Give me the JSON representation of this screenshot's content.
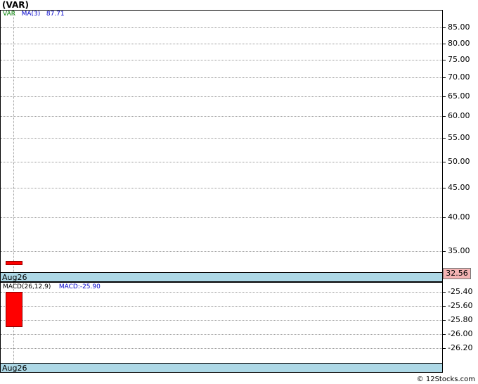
{
  "title": "(VAR)",
  "price_panel": {
    "legend_symbol": "VAR",
    "legend_ma": "MA(3)",
    "legend_ma_value": "87.71",
    "ticks": [
      "85.00",
      "80.00",
      "75.00",
      "70.00",
      "65.00",
      "60.00",
      "55.00",
      "50.00",
      "45.00",
      "40.00",
      "35.00"
    ],
    "last_price": "32.56",
    "date_label": "Aug26"
  },
  "macd_panel": {
    "legend_name": "MACD(26,12,9)",
    "legend_value": "MACD:-25.90",
    "ticks": [
      "-25.40",
      "-25.60",
      "-25.80",
      "-26.00",
      "-26.20"
    ],
    "date_label": "Aug26"
  },
  "footer": "© 12Stocks.com",
  "colors": {
    "up": "#ff0000",
    "date_bar": "#add8e6",
    "ma_legend": "#0000cc",
    "symbol_legend": "#008000"
  },
  "chart_data": [
    {
      "type": "bar",
      "title": "(VAR)",
      "categories": [
        "Aug26"
      ],
      "series": [
        {
          "name": "VAR",
          "values": [
            32.56
          ]
        }
      ],
      "ylim": [
        32.3,
        88.7
      ]
    },
    {
      "type": "bar",
      "title": "MACD(26,12,9)",
      "categories": [
        "Aug26"
      ],
      "series": [
        {
          "name": "MACD",
          "values": [
            -25.9
          ]
        }
      ],
      "ylim": [
        -26.43,
        -25.27
      ]
    }
  ]
}
